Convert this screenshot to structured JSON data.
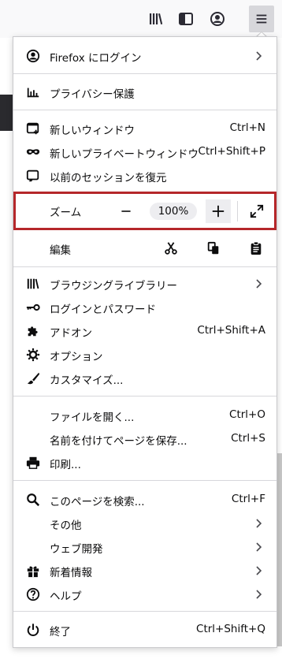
{
  "toolbar": {
    "icons": [
      "library-icon",
      "sidebar-icon",
      "account-icon",
      "hamburger-menu-icon"
    ]
  },
  "menu": {
    "signin": {
      "label": "Firefox にログイン"
    },
    "privacy": {
      "label": "プライバシー保護"
    },
    "new_window": {
      "label": "新しいウィンドウ",
      "shortcut": "Ctrl+N"
    },
    "new_private": {
      "label": "新しいプライベートウィンドウ",
      "shortcut": "Ctrl+Shift+P"
    },
    "restore": {
      "label": "以前のセッションを復元"
    },
    "zoom": {
      "label": "ズーム",
      "value": "100%"
    },
    "edit": {
      "label": "編集"
    },
    "library": {
      "label": "ブラウジングライブラリー"
    },
    "logins": {
      "label": "ログインとパスワード"
    },
    "addons": {
      "label": "アドオン",
      "shortcut": "Ctrl+Shift+A"
    },
    "options": {
      "label": "オプション"
    },
    "customize": {
      "label": "カスタマイズ..."
    },
    "open_file": {
      "label": "ファイルを開く...",
      "shortcut": "Ctrl+O"
    },
    "save_page": {
      "label": "名前を付けてページを保存...",
      "shortcut": "Ctrl+S"
    },
    "print": {
      "label": "印刷..."
    },
    "find": {
      "label": "このページを検索...",
      "shortcut": "Ctrl+F"
    },
    "more": {
      "label": "その他"
    },
    "webdev": {
      "label": "ウェブ開発"
    },
    "whatsnew": {
      "label": "新着情報"
    },
    "help": {
      "label": "ヘルプ"
    },
    "quit": {
      "label": "終了",
      "shortcut": "Ctrl+Shift+Q"
    }
  },
  "colors": {
    "highlight_border": "#b5272a",
    "separator": "#d7d7db",
    "button_bg": "#ededf0"
  }
}
